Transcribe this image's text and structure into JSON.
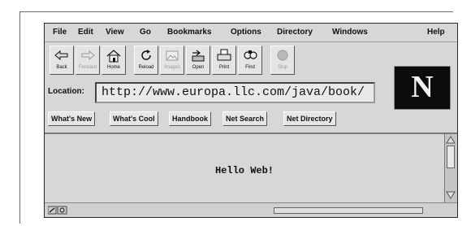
{
  "menu": [
    "File",
    "Edit",
    "View",
    "Go",
    "Bookmarks",
    "Options",
    "Directory",
    "Windows",
    "Help"
  ],
  "toolbar": [
    {
      "label": "Back",
      "icon": "back-arrow-icon",
      "disabled": false
    },
    {
      "label": "Forward",
      "icon": "forward-arrow-icon",
      "disabled": true
    },
    {
      "label": "Home",
      "icon": "home-icon",
      "disabled": false
    },
    {
      "label": "Reload",
      "icon": "reload-icon",
      "disabled": false
    },
    {
      "label": "Images",
      "icon": "images-icon",
      "disabled": true
    },
    {
      "label": "Open",
      "icon": "open-icon",
      "disabled": false
    },
    {
      "label": "Print",
      "icon": "print-icon",
      "disabled": false
    },
    {
      "label": "Find",
      "icon": "find-icon",
      "disabled": false
    },
    {
      "label": "Stop",
      "icon": "stop-icon",
      "disabled": true
    }
  ],
  "location": {
    "label": "Location:",
    "url": "http://www.europa.llc.com/java/book/"
  },
  "logo": {
    "letter": "N"
  },
  "directory_buttons": [
    "What's New",
    "What's Cool",
    "Handbook",
    "Net Search",
    "Net Directory"
  ],
  "page": {
    "text": "Hello Web!"
  }
}
